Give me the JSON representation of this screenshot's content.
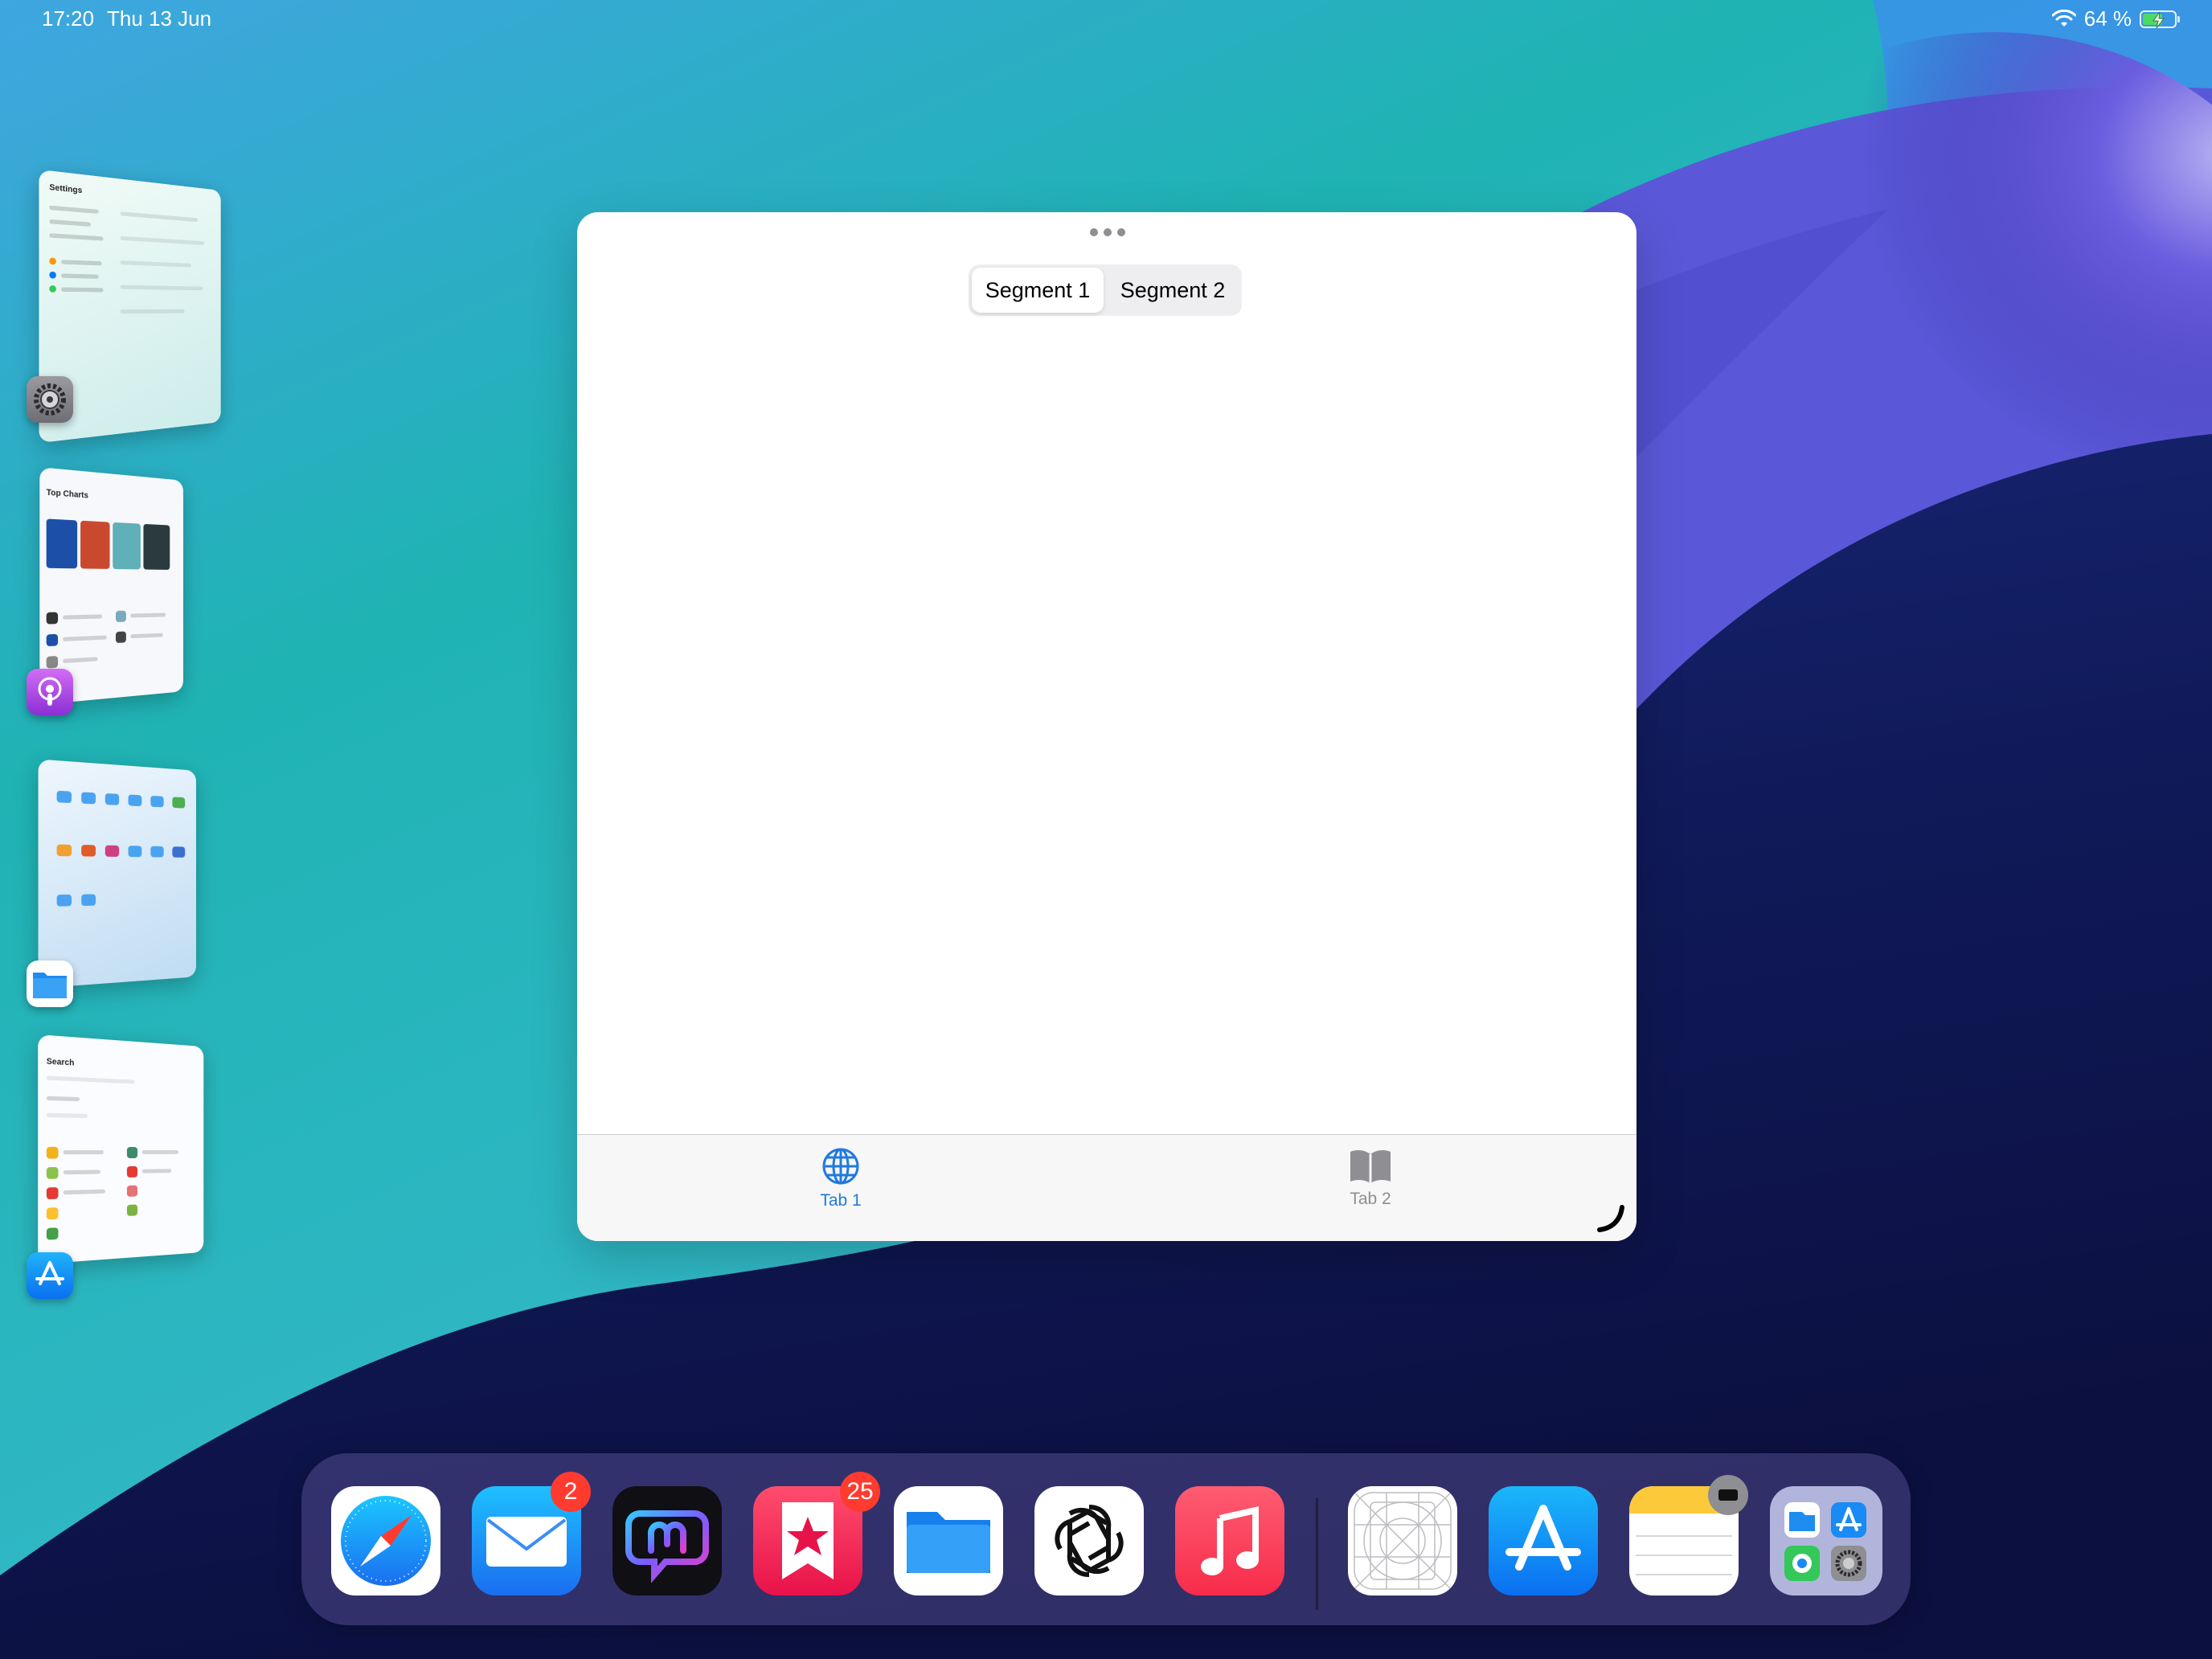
{
  "status_bar": {
    "time": "17:20",
    "date": "Thu 13 Jun",
    "battery_text": "64 %",
    "battery_level": 0.64,
    "charging": true,
    "wifi_icon": "wifi-icon"
  },
  "stage_manager": {
    "groups": [
      {
        "app": "Settings",
        "icon": "settings-gear-icon"
      },
      {
        "app": "Podcasts",
        "icon": "podcasts-icon"
      },
      {
        "app": "Files",
        "icon": "files-folder-icon"
      },
      {
        "app": "App Store",
        "icon": "app-store-icon"
      }
    ],
    "settings_preview_title": "Settings",
    "podcasts_preview_title": "Top Charts",
    "appstore_preview_title": "Search"
  },
  "window": {
    "segments": [
      "Segment 1",
      "Segment 2"
    ],
    "selected_segment": 0,
    "tabs": [
      {
        "label": "Tab 1",
        "icon": "globe-icon",
        "selected": true
      },
      {
        "label": "Tab 2",
        "icon": "book-icon",
        "selected": false
      }
    ]
  },
  "dock": {
    "apps": [
      {
        "name": "Safari",
        "icon": "safari-compass-icon"
      },
      {
        "name": "Mail",
        "icon": "mail-envelope-icon",
        "badge": "2"
      },
      {
        "name": "Mastodon client",
        "icon": "chat-bubble-icon"
      },
      {
        "name": "Bookmarks",
        "icon": "star-bookmark-icon",
        "badge": "25"
      },
      {
        "name": "Files",
        "icon": "files-folder-icon"
      },
      {
        "name": "ChatGPT",
        "icon": "chatgpt-knot-icon"
      },
      {
        "name": "Music",
        "icon": "music-note-icon"
      },
      {
        "name": "Icon Template",
        "icon": "grid-template-icon"
      },
      {
        "name": "App Store",
        "icon": "app-store-icon"
      },
      {
        "name": "Notes",
        "icon": "notes-icon"
      },
      {
        "name": "App Library",
        "icon": "app-library-icon"
      }
    ]
  },
  "colors": {
    "accent": "#1f7ae0",
    "badge": "#ff3b30",
    "inactive_tab": "#8e8e93"
  }
}
